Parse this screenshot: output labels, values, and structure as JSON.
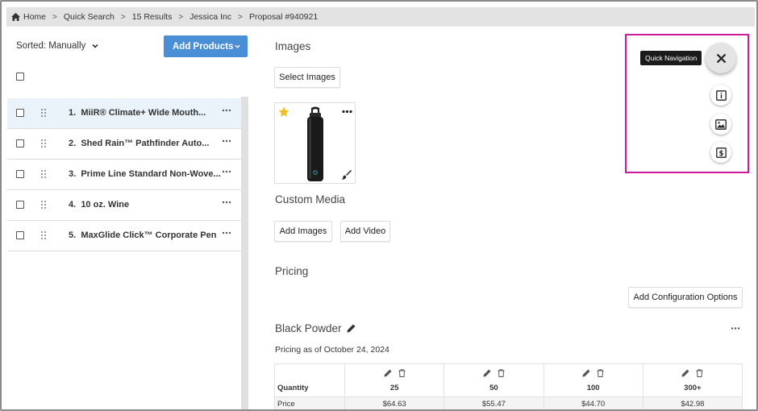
{
  "breadcrumb": {
    "items": [
      "Home",
      "Quick Search",
      "15 Results",
      "Jessica Inc",
      "Proposal #940921"
    ]
  },
  "left_panel": {
    "sort_label": "Sorted: Manually",
    "add_products_label": "Add Products",
    "products": [
      {
        "number": "1.",
        "name": "MiiR® Climate+ Wide Mouth..."
      },
      {
        "number": "2.",
        "name": "Shed Rain™ Pathfinder Auto..."
      },
      {
        "number": "3.",
        "name": "Prime Line Standard Non-Wove..."
      },
      {
        "number": "4.",
        "name": "10 oz. Wine"
      },
      {
        "number": "5.",
        "name": "MaxGlide Click™ Corporate Pen"
      }
    ]
  },
  "images": {
    "title": "Images",
    "select_images_label": "Select Images"
  },
  "custom_media": {
    "title": "Custom Media",
    "add_images_label": "Add Images",
    "add_video_label": "Add Video"
  },
  "pricing": {
    "title": "Pricing",
    "add_config_label": "Add Configuration Options",
    "config_name": "Black Powder",
    "as_of": "Pricing as of October 24, 2024",
    "table": {
      "quantity_label": "Quantity",
      "price_label": "Price",
      "quantities": [
        "25",
        "50",
        "100",
        "300+"
      ],
      "prices": [
        "$64.63",
        "$55.47",
        "$44.70",
        "$42.98"
      ]
    }
  },
  "quick_nav": {
    "tooltip": "Quick Navigation"
  },
  "colors": {
    "primary_button": "#4a8ed6",
    "quick_nav_highlight": "#d0199a",
    "active_row": "#eaf2fa",
    "star": "#f2c01e"
  }
}
